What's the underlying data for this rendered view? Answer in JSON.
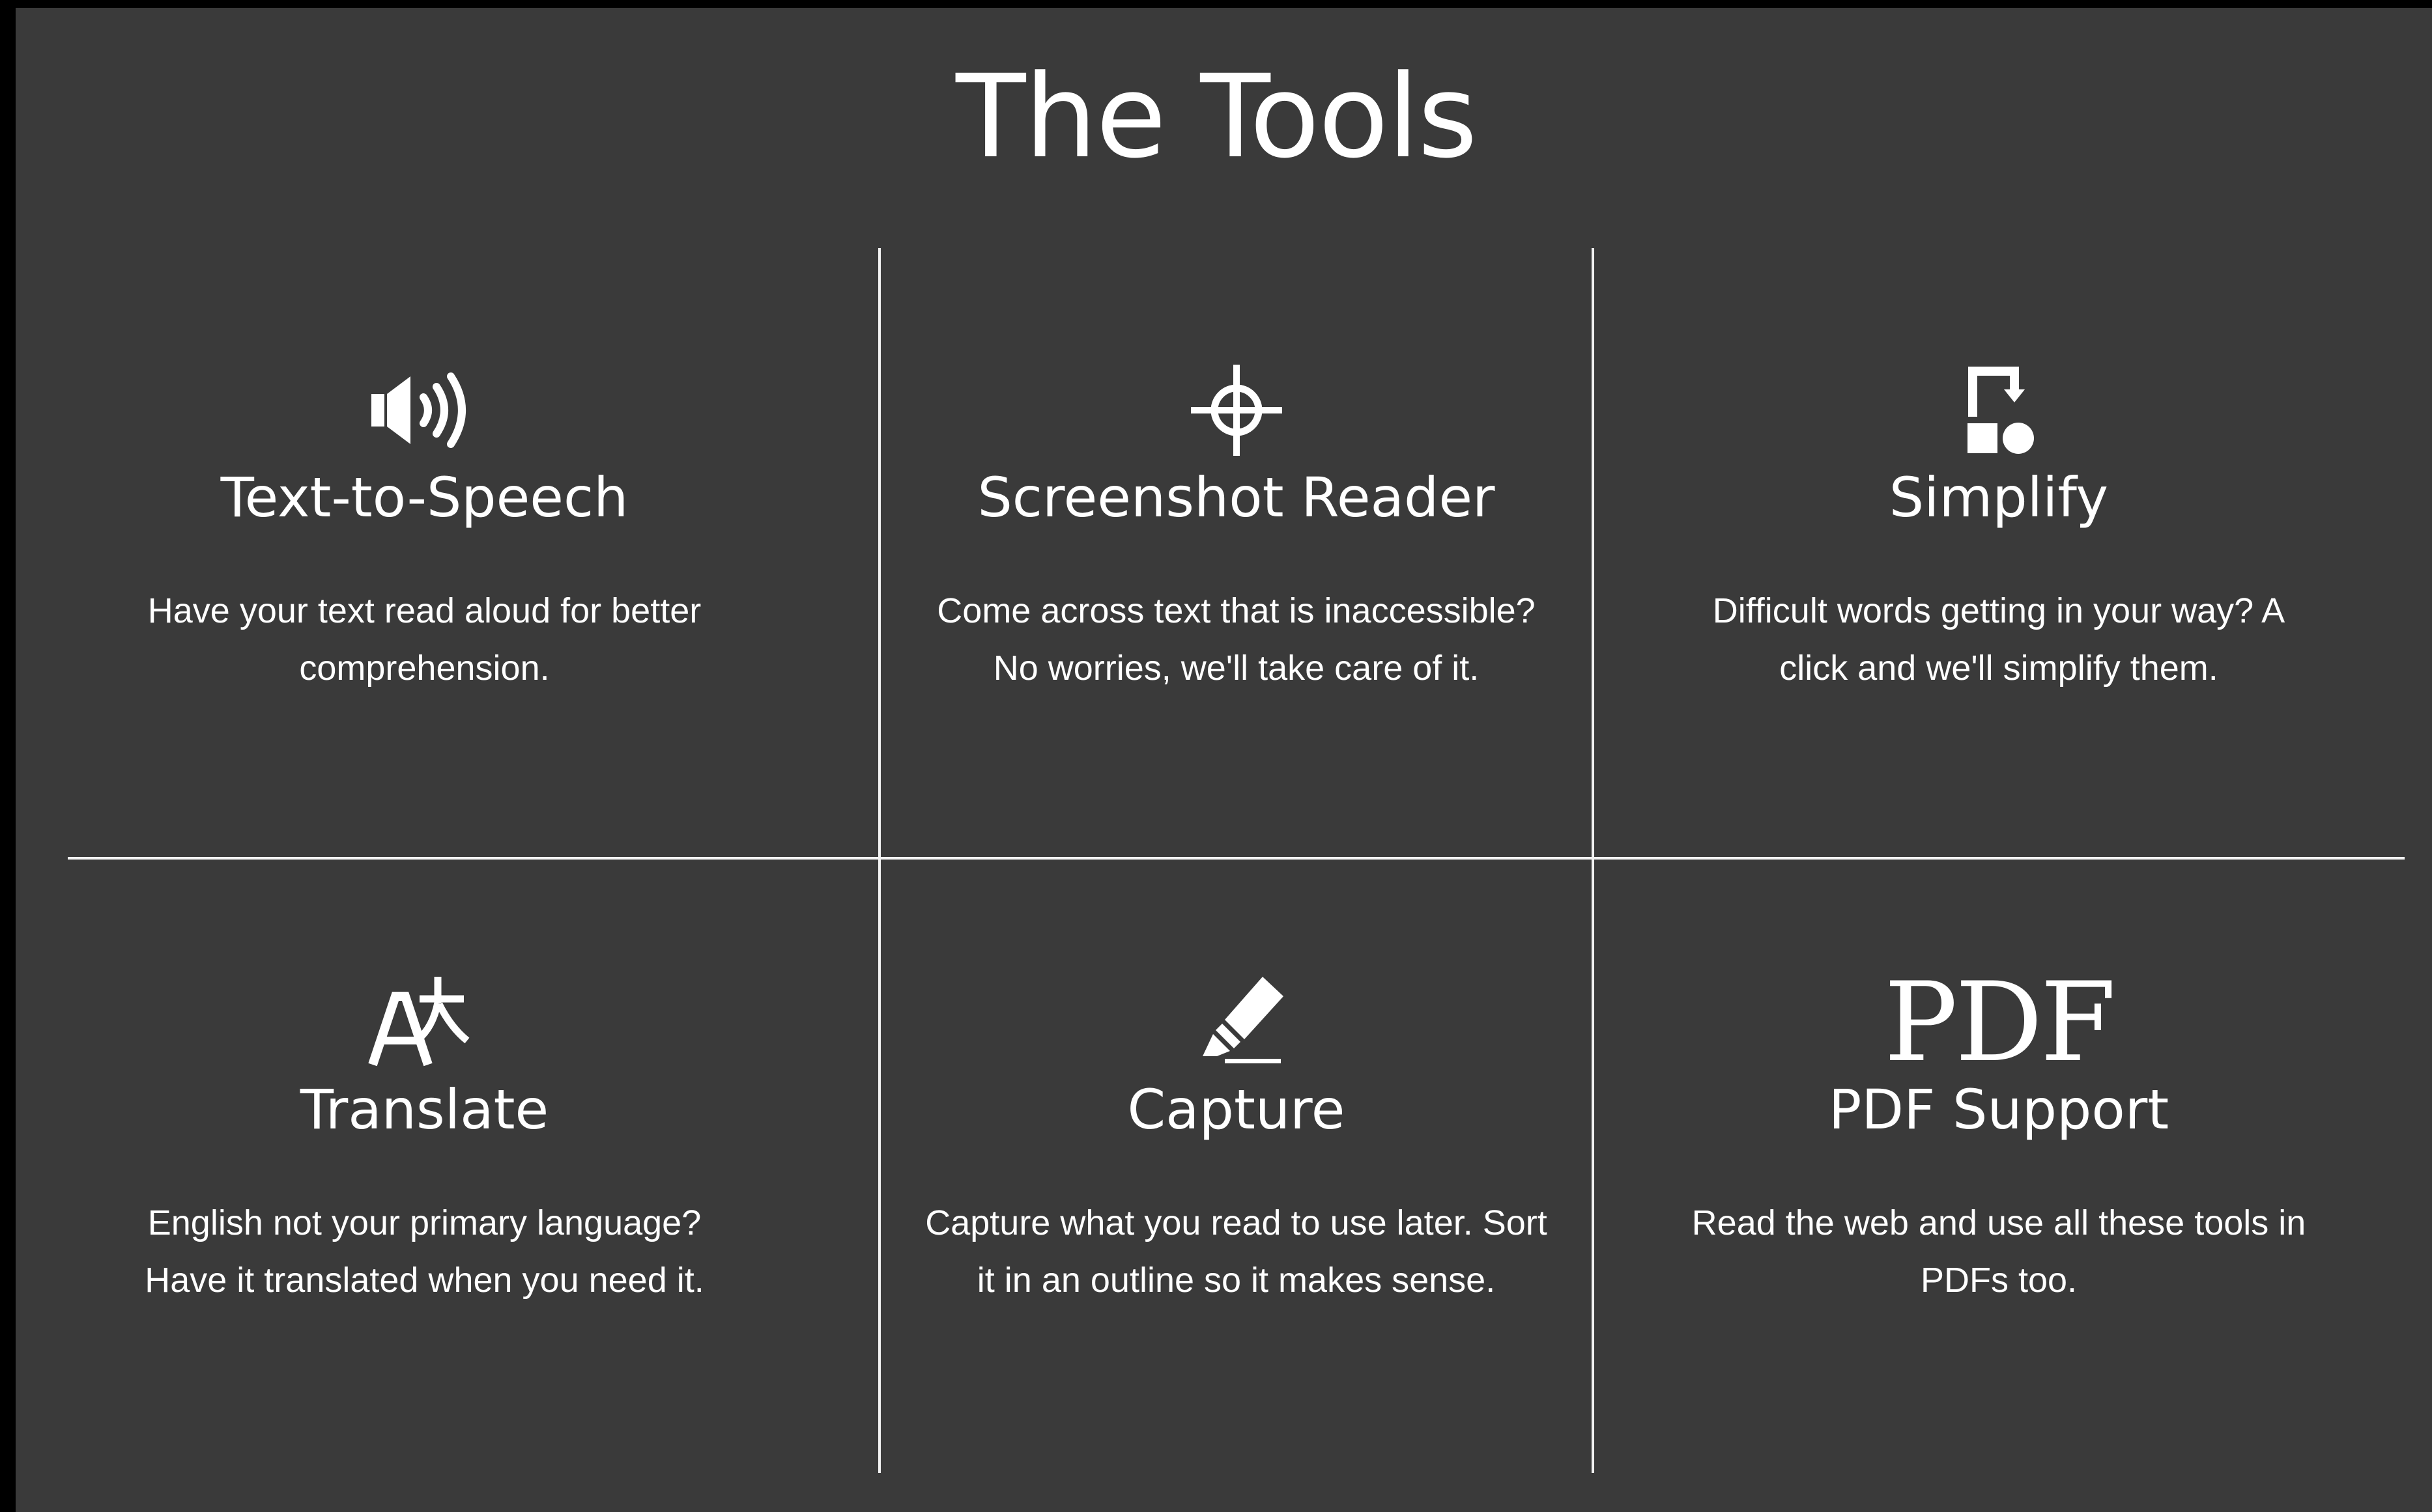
{
  "page": {
    "title": "The Tools"
  },
  "colors": {
    "background": "#3a3a3a",
    "text": "#ffffff",
    "divider": "#f2f2f2"
  },
  "tools": [
    {
      "icon": "speaker-icon",
      "title": "Text-to-Speech",
      "description": "Have your text read aloud for better comprehension."
    },
    {
      "icon": "crosshair-icon",
      "title": "Screenshot Reader",
      "description": "Come across text that is inaccessible? No worries, we'll take care of it."
    },
    {
      "icon": "simplify-icon",
      "title": "Simplify",
      "description": "Difficult words getting in your way? A click and we'll simplify them."
    },
    {
      "icon": "translate-icon",
      "title": "Translate",
      "description": "English not your primary language? Have it translated when you need it."
    },
    {
      "icon": "highlighter-icon",
      "title": "Capture",
      "description": "Capture what you read to use later. Sort it in an outline so it makes sense."
    },
    {
      "icon": "pdf-icon",
      "icon_text": "PDF",
      "title": "PDF Support",
      "description": "Read the web and use all these tools in PDFs too."
    }
  ]
}
